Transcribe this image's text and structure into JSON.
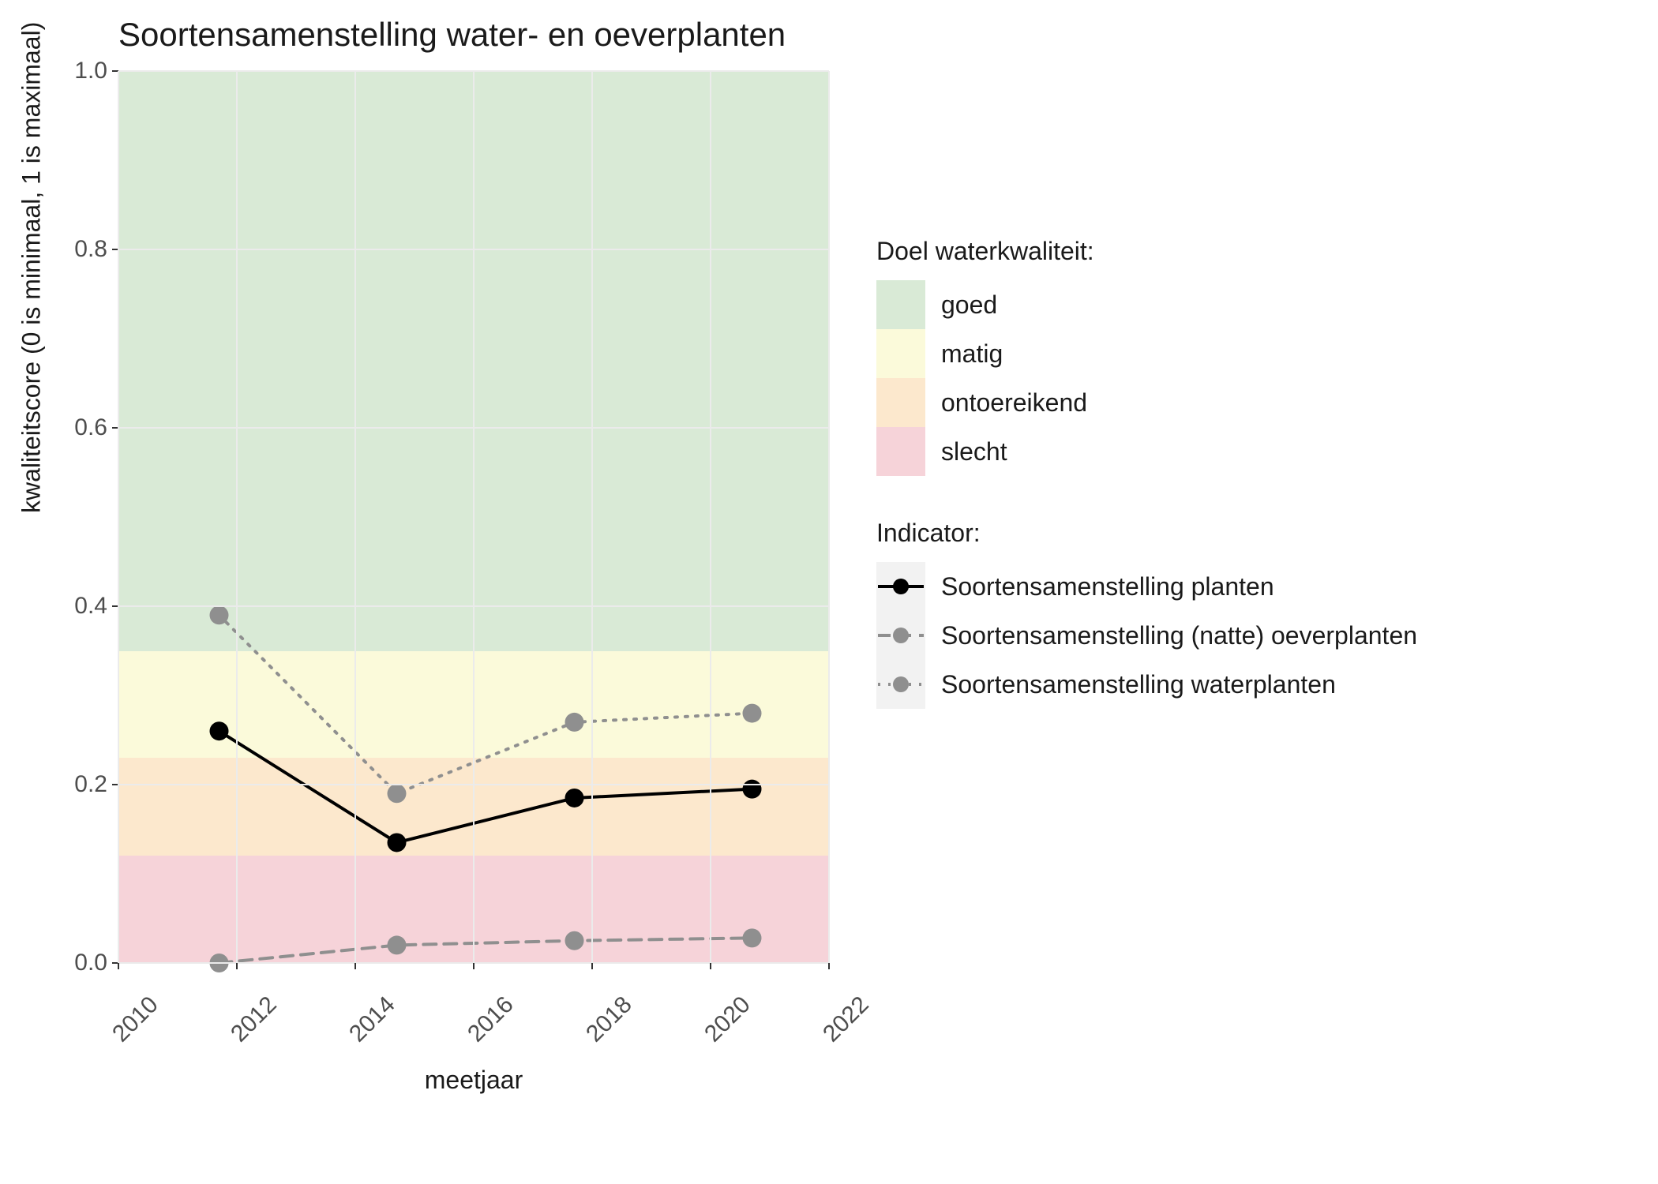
{
  "chart_data": {
    "type": "line",
    "title": "Soortensamenstelling water- en oeverplanten",
    "xlabel": "meetjaar",
    "ylabel": "kwaliteitscore (0 is minimaal, 1 is maximaal)",
    "xlim": [
      2010,
      2022
    ],
    "ylim": [
      0.0,
      1.0
    ],
    "x_ticks": [
      2010,
      2012,
      2014,
      2016,
      2018,
      2020,
      2022
    ],
    "y_ticks": [
      0.0,
      0.2,
      0.4,
      0.6,
      0.8,
      1.0
    ],
    "bands": [
      {
        "name": "goed",
        "from": 0.35,
        "to": 1.0,
        "color": "#d9ead6"
      },
      {
        "name": "matig",
        "from": 0.23,
        "to": 0.35,
        "color": "#fbfada"
      },
      {
        "name": "ontoereikend",
        "from": 0.12,
        "to": 0.23,
        "color": "#fce8cd"
      },
      {
        "name": "slecht",
        "from": 0.0,
        "to": 0.12,
        "color": "#f6d3d9"
      }
    ],
    "series": [
      {
        "name": "Soortensamenstelling planten",
        "color": "#000000",
        "dash": "solid",
        "points": [
          {
            "x": 2011.7,
            "y": 0.26
          },
          {
            "x": 2014.7,
            "y": 0.135
          },
          {
            "x": 2017.7,
            "y": 0.185
          },
          {
            "x": 2020.7,
            "y": 0.195
          }
        ]
      },
      {
        "name": "Soortensamenstelling (natte) oeverplanten",
        "color": "#8f8f8f",
        "dash": "dashed",
        "points": [
          {
            "x": 2011.7,
            "y": 0.0
          },
          {
            "x": 2014.7,
            "y": 0.02
          },
          {
            "x": 2017.7,
            "y": 0.025
          },
          {
            "x": 2020.7,
            "y": 0.028
          }
        ]
      },
      {
        "name": "Soortensamenstelling waterplanten",
        "color": "#8f8f8f",
        "dash": "dotted",
        "points": [
          {
            "x": 2011.7,
            "y": 0.39
          },
          {
            "x": 2014.7,
            "y": 0.19
          },
          {
            "x": 2017.7,
            "y": 0.27
          },
          {
            "x": 2020.7,
            "y": 0.28
          }
        ]
      }
    ]
  },
  "legend": {
    "quality_title": "Doel waterkwaliteit:",
    "quality_items": [
      "goed",
      "matig",
      "ontoereikend",
      "slecht"
    ],
    "indicator_title": "Indicator:"
  }
}
